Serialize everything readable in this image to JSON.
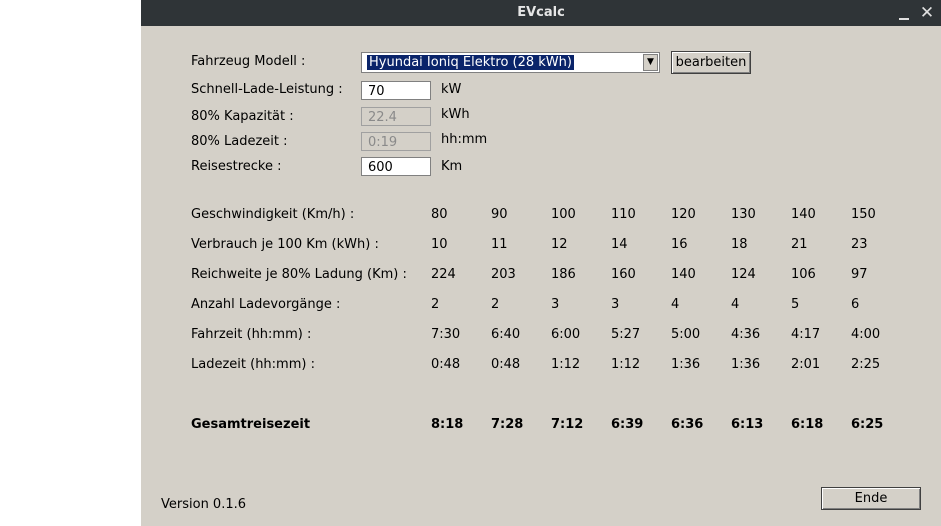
{
  "window": {
    "title": "EVcalc",
    "minimize_glyph": "_",
    "close_glyph": "✕"
  },
  "form": {
    "model_label": "Fahrzeug Modell :",
    "model_value": "Hyundai Ioniq Elektro (28 kWh)",
    "edit_button": "bearbeiten",
    "charge_power_label": "Schnell-Lade-Leistung :",
    "charge_power_value": "70",
    "charge_power_unit": "kW",
    "capacity_label": "80% Kapazität :",
    "capacity_value": "22.4",
    "capacity_unit": "kWh",
    "charge_time_label": "80% Ladezeit :",
    "charge_time_value": "0:19",
    "charge_time_unit": "hh:mm",
    "distance_label": "Reisestrecke :",
    "distance_value": "600",
    "distance_unit": "Km"
  },
  "table": {
    "rows": [
      {
        "label": "Geschwindigkeit (Km/h) :",
        "values": [
          "80",
          "90",
          "100",
          "110",
          "120",
          "130",
          "140",
          "150"
        ]
      },
      {
        "label": "Verbrauch je 100 Km (kWh) :",
        "values": [
          "10",
          "11",
          "12",
          "14",
          "16",
          "18",
          "21",
          "23"
        ]
      },
      {
        "label": "Reichweite je 80% Ladung (Km) :",
        "values": [
          "224",
          "203",
          "186",
          "160",
          "140",
          "124",
          "106",
          "97"
        ]
      },
      {
        "label": "Anzahl Ladevorgänge :",
        "values": [
          "2",
          "2",
          "3",
          "3",
          "4",
          "4",
          "5",
          "6"
        ]
      },
      {
        "label": "Fahrzeit (hh:mm) :",
        "values": [
          "7:30",
          "6:40",
          "6:00",
          "5:27",
          "5:00",
          "4:36",
          "4:17",
          "4:00"
        ]
      },
      {
        "label": "Ladezeit (hh:mm) :",
        "values": [
          "0:48",
          "0:48",
          "1:12",
          "1:12",
          "1:36",
          "1:36",
          "2:01",
          "2:25"
        ]
      }
    ],
    "total": {
      "label": "Gesamtreisezeit",
      "values": [
        "8:18",
        "7:28",
        "7:12",
        "6:39",
        "6:36",
        "6:13",
        "6:18",
        "6:25"
      ]
    }
  },
  "footer": {
    "version": "Version 0.1.6",
    "end_button": "Ende"
  }
}
